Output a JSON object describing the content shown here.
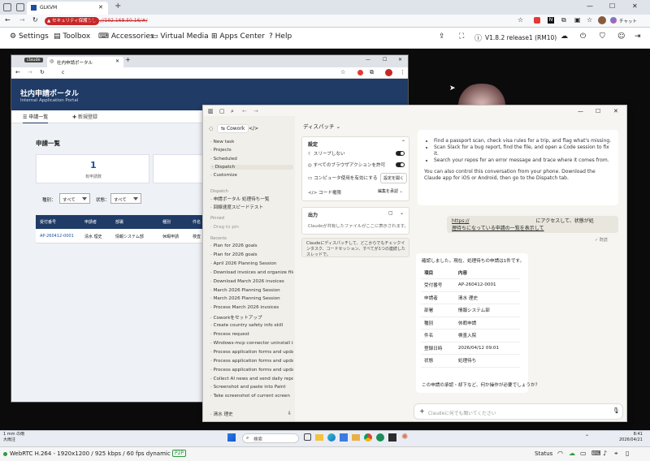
{
  "outer": {
    "tab_title": "GLKVM",
    "security_badge": "セキュリティ保護なし",
    "url": "https://192.168.50.16/#/",
    "toolbar": {
      "settings": "Settings",
      "toolbox": "Toolbox",
      "accessories": "Accessories",
      "virtual_media": "Virtual Media",
      "apps_center": "Apps Center",
      "help": "Help",
      "version": "V1.8.2 release1 (RM10)"
    },
    "chat_label": "チャット"
  },
  "inner": {
    "tab_badge": "claude",
    "tab_title": "社内申請ポータル",
    "url": "c",
    "portal_title": "社内申請ポータル",
    "portal_subtitle": "Internal Application Portal",
    "tabs": [
      "申請一覧",
      "新規登録"
    ],
    "section_title": "申請一覧",
    "stat_value": "1",
    "stat_label": "有申請数",
    "filter_type_label": "種別：",
    "filter_type_value": "すべて",
    "filter_status_label": "状態：",
    "filter_status_value": "すべて",
    "table_headers": [
      "受付番号",
      "申請者",
      "部署",
      "種別",
      "件名"
    ],
    "table_row": [
      "AP-260412-0001",
      "清水 理史",
      "情報システム部",
      "休暇申請",
      "検査"
    ]
  },
  "claude": {
    "sidebar": {
      "mode": "Cowork",
      "nav": [
        "New task",
        "Projects",
        "Scheduled",
        "Dispatch",
        "Customize"
      ],
      "dispatch_header": "Dispatch",
      "dispatch_items": [
        "申請ポータル 処理待ち一覧",
        "回線速度スピードテスト"
      ],
      "pinned_header": "Pinned",
      "pinned_hint": "Drag to pin",
      "recents_header": "Recents",
      "recents": [
        "Plan for 2026 goals",
        "Plan for 2026 goals",
        "April 2026 Planning Session",
        "Download invoices and organize files",
        "Download March 2026 invoices",
        "March 2026 Planning Session",
        "March 2026 Planning Session",
        "Process March 2026 invoices",
        "Coworkをセットアップ",
        "Create country safety info skill",
        "Process request",
        "Windows-mcp connector uninstall issue",
        "Process application forms and updates",
        "Process application forms and updates",
        "Process application forms and updates",
        "Collect AI news and send daily report",
        "Screenshot and paste into Paint",
        "Take screenshot of current screen"
      ],
      "user": "清水 理史"
    },
    "header_title": "ディスパッチ",
    "settings_card": {
      "title": "設定",
      "sleep": "スリープしない",
      "browser_actions": "すべてのブラウザアクションを許可",
      "computer_use": "コンピュータ使用を有効にする",
      "computer_use_button": "設定を開く",
      "code_perm": "コード権限",
      "code_perm_value": "編集を承認"
    },
    "output_card": {
      "title": "出力",
      "desc": "Claudeが共有したファイルがここに表示されます。"
    },
    "info_note": "Claudeにディスパッチして、どこからでもチェックインタスク、コードセッション、すべてが1つの連続したスレッドで。",
    "intro": {
      "bullets": [
        "Find a passport scan, check visa rules for a trip, and flag what's missing.",
        "Scan Slack for a bug report, find the file, and open a Code session to fix it.",
        "Search your repos for an error message and trace where it comes from."
      ],
      "footer": "You can also control this conversation from your phone. Download the Claude app for iOS or Android, then go to the Dispatch tab."
    },
    "user_message": {
      "link": "https://",
      "text1": "にアクセスして、状態が処",
      "text2": "理待ちになっている申請の一覧を表示して",
      "read": "既読"
    },
    "reply": {
      "intro": "確認しました。現在、処理待ちの申請は1件です。",
      "head": [
        "項目",
        "内容"
      ],
      "rows": [
        [
          "受付番号",
          "AP-260412-0001"
        ],
        [
          "申請者",
          "清水 理史"
        ],
        [
          "部署",
          "情報システム部"
        ],
        [
          "種別",
          "休暇申請"
        ],
        [
          "件名",
          "検査入院"
        ],
        [
          "登録日時",
          "2026/04/12 09:01"
        ],
        [
          "状態",
          "処理待ち"
        ]
      ],
      "outro": "この申請の承認・却下など、何か操作が必要でしょうか？"
    },
    "input_placeholder": "Claudeに何でも聞いてください"
  },
  "taskbar": {
    "weather_temp": "1 mm の雨",
    "weather_sub": "大雨注",
    "search_placeholder": "検索",
    "time": "8:41",
    "date": "2026/04/21"
  },
  "statusbar": {
    "stream_info": "WebRTC H.264 - 1920x1200 / 925 kbps / 60 fps dynamic",
    "mode_badge": "P2P",
    "status_label": "Status"
  }
}
